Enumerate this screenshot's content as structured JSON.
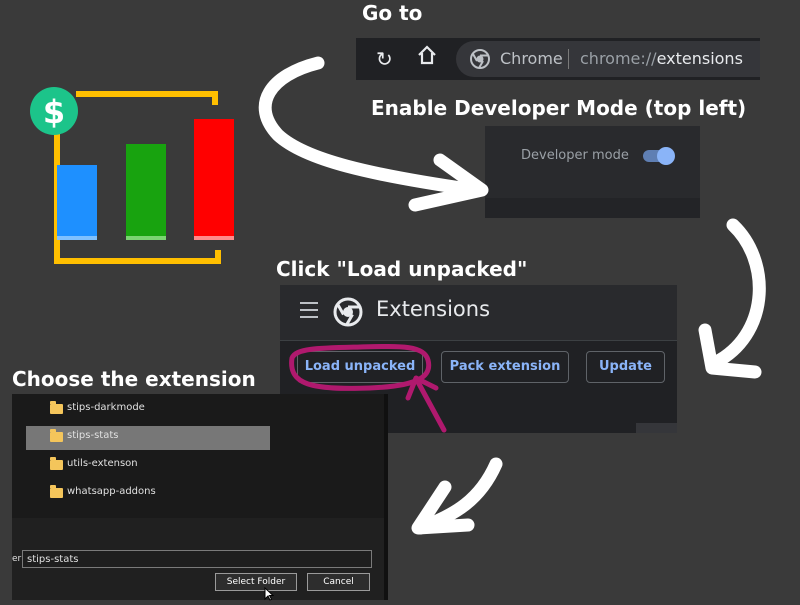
{
  "headings": {
    "go_to": "Go to",
    "enable_dev": "Enable Developer Mode (top left)",
    "click_load": "Click \"Load unpacked\"",
    "choose_ext": "Choose the extension"
  },
  "logo": {
    "symbol": "$",
    "bar_colors": [
      "#1e90ff",
      "#18a30f",
      "#ff0000"
    ],
    "frame_color": "#ffbf00",
    "badge_color": "#1cc48a"
  },
  "browser": {
    "site_label": "Chrome",
    "url_prefix": "chrome://",
    "url_path": "extensions",
    "icons": [
      "reload-icon",
      "home-icon",
      "chrome-logo-icon"
    ]
  },
  "dev_mode": {
    "label": "Developer mode",
    "enabled": true
  },
  "extensions_page": {
    "title": "Extensions",
    "buttons": [
      "Load unpacked",
      "Pack extension",
      "Update"
    ]
  },
  "file_dialog": {
    "folders": [
      "stips-darkmode",
      "stips-stats",
      "utils-extenson",
      "whatsapp-addons"
    ],
    "selected_folder": "stips-stats",
    "field_label": "er:",
    "field_value": "stips-stats",
    "select_button": "Select Folder",
    "cancel_button": "Cancel"
  },
  "colors": {
    "background": "#3a3a3a",
    "accent": "#8ab4f8",
    "highlight": "#b0196e"
  }
}
